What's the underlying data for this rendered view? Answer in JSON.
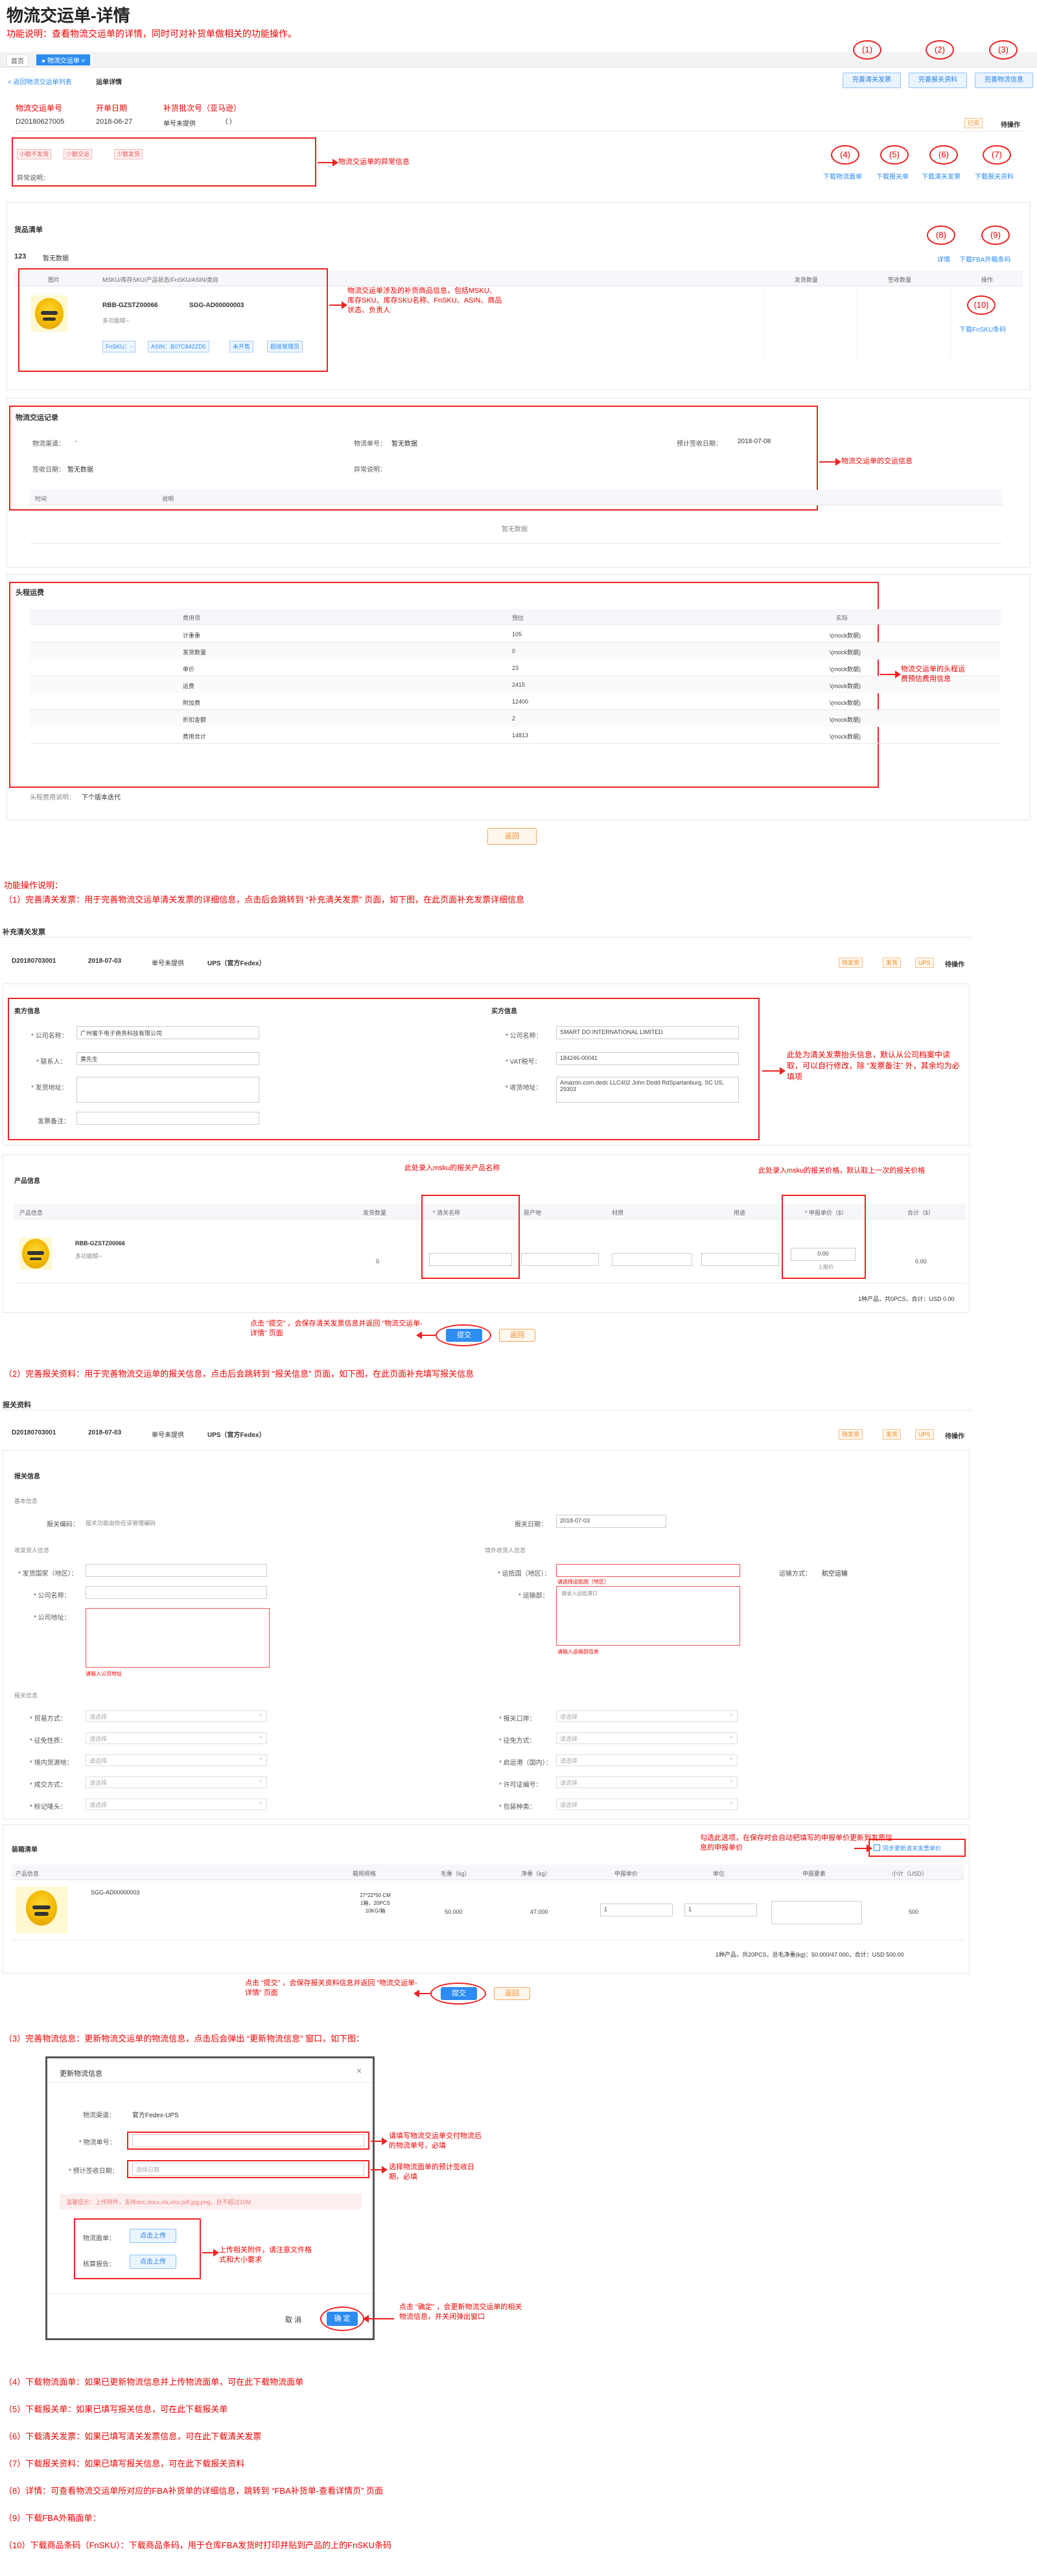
{
  "header": {
    "title": "物流交运单-详情",
    "desc": "功能说明：查看物流交运单的详情，同时可对补货单做相关的功能操作。"
  },
  "top_tabs": {
    "home": "首页",
    "active": "● 物流交运单 ×"
  },
  "breadcrumb": {
    "back": "< 返回物流交运单列表",
    "current": "运单详情"
  },
  "detail": {
    "labels": [
      "物流交运单号",
      "开单日期",
      "补货批次号（亚马逊）"
    ],
    "order_no": "D20180627005",
    "date": "2018-06-27",
    "shipment_status": "单号未提供",
    "batch": "( )",
    "status_tag": "已完",
    "status_text": "待操作",
    "exception_tags": [
      "小额不发货",
      "少额交运",
      "少额发货"
    ],
    "exception_label": "异常说明："
  },
  "top_buttons": [
    "完善清关发票",
    "完善报关资料",
    "完善物流信息"
  ],
  "top_circles": [
    "(1)",
    "(2)",
    "(3)"
  ],
  "link_circles": [
    "(4)",
    "(5)",
    "(6)",
    "(7)"
  ],
  "links": [
    "下载物流面单",
    "下载报关单",
    "下载清关发票",
    "下载报关资料"
  ],
  "annotations": {
    "exception": "物流交运单的异常信息",
    "product": "物流交运单涉及的补货商品信息，包括MSKU、库存SKU、库存SKU名称、FnSKU、ASIN、商品状态、负责人",
    "shipping": "物流交运单的交运信息",
    "cost": "物流交运单的头程运费预估费用信息"
  },
  "product_section": {
    "title": "货品清单",
    "count": "123",
    "count_note": "暂无数据",
    "circles": [
      "(8)",
      "(9)",
      "(10)"
    ],
    "links": [
      "详情",
      "下载FBA外箱条码",
      "下载FnSKU条码"
    ],
    "columns": [
      "图片",
      "MSKU/库存SKU/产品状态/FnSKU/ASIN/类目",
      "发货数量",
      "签收数量",
      "操作"
    ],
    "msku": "RBB-GZSTZ00066",
    "sku": "SGG-AD00000003",
    "sku_name": "多功能晾~",
    "tags": [
      "FnSKU：-",
      "ASIN：B07C842ZD5",
      "未开售",
      "超级管理员"
    ]
  },
  "shipping_section": {
    "title": "物流交运记录",
    "labels": [
      "物流渠道：",
      "物流单号：",
      "预计签收日期：",
      "签收日期：",
      "异常说明："
    ],
    "values": [
      "-",
      "暂无数据",
      "2018-07-08",
      "暂无数据",
      ""
    ],
    "table_cols": [
      "时间",
      "说明"
    ],
    "empty": "暂无数据"
  },
  "cost_section": {
    "title": "头程运费",
    "columns": [
      "费用项",
      "预估",
      "实际"
    ],
    "rows": [
      [
        "计重重",
        "105",
        "\\(mock数据)"
      ],
      [
        "发货数量",
        "0",
        "\\(mock数据)"
      ],
      [
        "单价",
        "23",
        "\\(mock数据)"
      ],
      [
        "运费",
        "2415",
        "\\(mock数据)"
      ],
      [
        "附加费",
        "12400",
        "\\(mock数据)"
      ],
      [
        "折扣金额",
        "2",
        "\\(mock数据)"
      ],
      [
        "费用合计",
        "14813",
        "\\(mock数据)"
      ]
    ],
    "footer_label": "头程费用说明：",
    "footer_text": "下个版本迭代",
    "back_button": "返回"
  },
  "ops_title": "功能操作说明：",
  "op1": {
    "text": "（1）完善清关发票：用于完善物流交运单清关发票的详细信息，点击后会跳转到 “补充清关发票” 页面，如下图，在此页面补充发票详细信息",
    "page_title": "补充清关发票",
    "order_no": "D20180703001",
    "date": "2018-07-03",
    "status": "单号未提供",
    "carrier": "UPS（官方Fedex）",
    "tags": [
      "待发货",
      "发货",
      "UPS"
    ],
    "status_text": "待操作",
    "seller_title": "卖方信息",
    "buyer_title": "买方信息",
    "seller_labels": [
      "* 公司名称：",
      "* 联系人：",
      "* 发货地址：",
      "发票备注："
    ],
    "seller_values": [
      "广州蜜千电子商务科技有限公司",
      "黄先生",
      "",
      ""
    ],
    "buyer_labels": [
      "* 公司名称：",
      "* VAT税号：",
      "* 收货地址："
    ],
    "buyer_values": [
      "SMART DO INTERNATIONAL LIMITED",
      "184246-00041",
      "Amazon.com.dedc LLC402 John Dodd RdSpartanburg, SC US, 29303"
    ],
    "buyer_note": "此处为清关发票抬头信息，默认从公司档案中读取，可以自行修改，除 “发票备注” 外，其余均为必填项",
    "product_title": "产品信息",
    "columns": [
      "产品信息",
      "发货数量",
      "* 清关名称",
      "原产地",
      "材质",
      "用途",
      "* 申报单价（$）",
      "合计（$）"
    ],
    "product_code": "RBB-GZSTZ00066",
    "product_name": "多功能晾~",
    "qty": "0",
    "price": "0.00",
    "price_hint": "上报价",
    "total": "0.00",
    "note_name": "此处录入msku的报关产品名称",
    "note_price": "此处录入msku的报关价格，默认取上一次的报关价格",
    "summary": "1种产品，共0PCS，合计：USD 0.00",
    "submit": "提交",
    "back": "返回",
    "note_submit": "点击 “提交” ，会保存清关发票信息并返回 “物流交运单-详情” 页面"
  },
  "op2": {
    "text": "（2）完善报关资料：用于完善物流交运单的报关信息，点击后会跳转到 “报关信息” 页面，如下图，在此页面补充填写报关信息",
    "page_title": "报关资料",
    "order_no": "D20180703001",
    "date": "2018-07-03",
    "status": "单号未提供",
    "carrier": "UPS（官方Fedex）",
    "tags": [
      "待发货",
      "发货",
      "UPS"
    ],
    "status_text": "待操作",
    "section": "报关信息",
    "basic": "基本信息",
    "code_label": "报关编码：",
    "code_value": "报关功能由你在该管理编码",
    "date_label": "报关日期：",
    "date_value": "2018-07-03",
    "export_title": "收发货人信息",
    "import_title": "境外收货人信息",
    "left_labels": [
      "* 发货国家（地区）：",
      "* 公司名称：",
      "* 公司地址："
    ],
    "right_labels": [
      "* 运抵国（地区）：",
      "* 运输部："
    ],
    "right_extra_label": "运输方式：",
    "right_extra_value": "航空运输",
    "hint_red": "请输入公司地址",
    "hint_red2": "请选择运抵国（地区）",
    "hint_red3": "请输入运输部信息",
    "placeholder_port": "请录入运抵港口",
    "customs_title": "报关信息",
    "left2_labels": [
      "* 贸易方式：",
      "* 征免性质：",
      "* 境内货源地：",
      "* 成交方式：",
      "* 标记唛头："
    ],
    "right2_labels": [
      "* 报关口岸：",
      "* 征免方式：",
      "* 启运港（国内）：",
      "* 许可证编号：",
      "* 包装种类："
    ],
    "select_ph": "请选择",
    "box_title": "装箱清单",
    "box_note": "勾选此选项，在保存时会自动把填写的申报单价更新到发票信息的申报单价",
    "box_checkbox": "同步更新清关发票单价",
    "box_cols": [
      "产品信息",
      "箱规规格",
      "毛重（kg）",
      "净重（kg）",
      "申报单价",
      "单位",
      "申报要素",
      "小计（USD）"
    ],
    "box_sku": "SGG-AD00000003",
    "box_spec": "27*22*50 CM\n1箱，20PCS\n10KG/箱",
    "box_gross": "50.000",
    "box_net": "47.000",
    "box_price": "1",
    "box_unit": "1",
    "box_total": "500",
    "box_summary": "1种产品，共20PCS，总毛净重(kg)：50.000/47.000，合计：USD 500.00",
    "submit": "提交",
    "back": "返回",
    "note_submit": "点击 “提交” ，会保存报关资料信息并返回 “物流交运单-详情” 页面"
  },
  "op3": {
    "text": "（3）完善物流信息：更新物流交运单的物流信息，点击后会弹出 “更新物流信息” 窗口，如下图：",
    "dialog_title": "更新物流信息",
    "close": "×",
    "channel_label": "物流渠道：",
    "channel_value": "官方Fedex-UPS",
    "tracking_label": "* 物流单号：",
    "eta_label": "* 预计签收日期：",
    "eta_placeholder": "选择日期",
    "tip": "温馨提示：上传附件，支持doc,docx,xls,xlsx,pdf,jpg,png，且不超过10M",
    "label_label": "物流面单：",
    "list_label": "核算报告：",
    "upload": "点击上传",
    "cancel": "取 消",
    "ok": "确 定",
    "note_tracking": "请填写物流交运单交付物流后的物流单号，必填",
    "note_eta": "选择物流面单的预计签收日期，必填",
    "note_upload": "上传相关附件，请注意文件格式和大小要求",
    "note_ok": "点击 “确定” ，会更新物流交运单的相关物流信息，并关闭弹出窗口"
  },
  "ops_list": [
    "（4）下载物流面单：如果已更新物流信息并上传物流面单，可在此下载物流面单",
    "（5）下载报关单：如果已填写报关信息，可在此下载报关单",
    "（6）下载清关发票：如果已填写清关发票信息，可在此下载清关发票",
    "（7）下载报关资料：如果已填写报关信息，可在此下载报关资料",
    "（8）详情：可查看物流交运单所对应的FBA补货单的详细信息，跳转到 “FBA补货单-查看详情页” 页面",
    "（9）下载FBA外箱面单：",
    "（10）下载商品条码（FnSKU）：下载商品条码，用于仓库FBA发货时打印并贴到产品的上的FnSKU条码"
  ],
  "colors": {
    "red": "#e22222",
    "blue": "#2d8cf0",
    "orange": "#f08a24"
  }
}
